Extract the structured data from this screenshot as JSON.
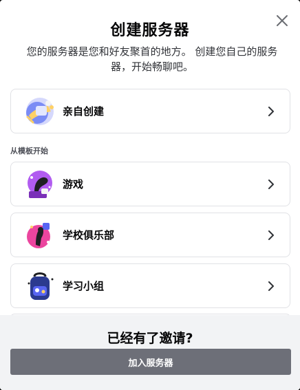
{
  "modal": {
    "title": "创建服务器",
    "subtitle": "您的服务器是您和好友聚首的地方。 创建您自己的服务器，开始畅聊吧。"
  },
  "create_own": {
    "label": "亲自创建",
    "icon": "create-own-icon"
  },
  "templates": {
    "section_label": "从模板开始",
    "items": [
      {
        "label": "游戏",
        "icon": "gaming-icon"
      },
      {
        "label": "学校俱乐部",
        "icon": "school-club-icon"
      },
      {
        "label": "学习小组",
        "icon": "study-group-icon"
      }
    ]
  },
  "footer": {
    "title": "已经有了邀请?",
    "join_label": "加入服务器"
  },
  "colors": {
    "button_gray": "#6d6f78",
    "footer_bg": "#f2f3f5",
    "border": "#e0e1e5"
  }
}
